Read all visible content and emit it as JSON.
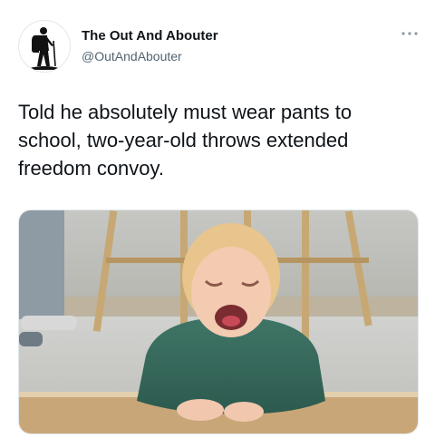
{
  "tweet": {
    "author_name": "The Out And Abouter",
    "author_handle": "@OutAndAbouter",
    "more_label": "···",
    "text": "Told he absolutely must wear pants to school, two-year-old throws extended freedom convoy."
  },
  "icons": {
    "avatar": "hiker-silhouette-icon",
    "more": "more-options-icon"
  },
  "colors": {
    "text": "#0f1419",
    "secondary": "#536471"
  }
}
